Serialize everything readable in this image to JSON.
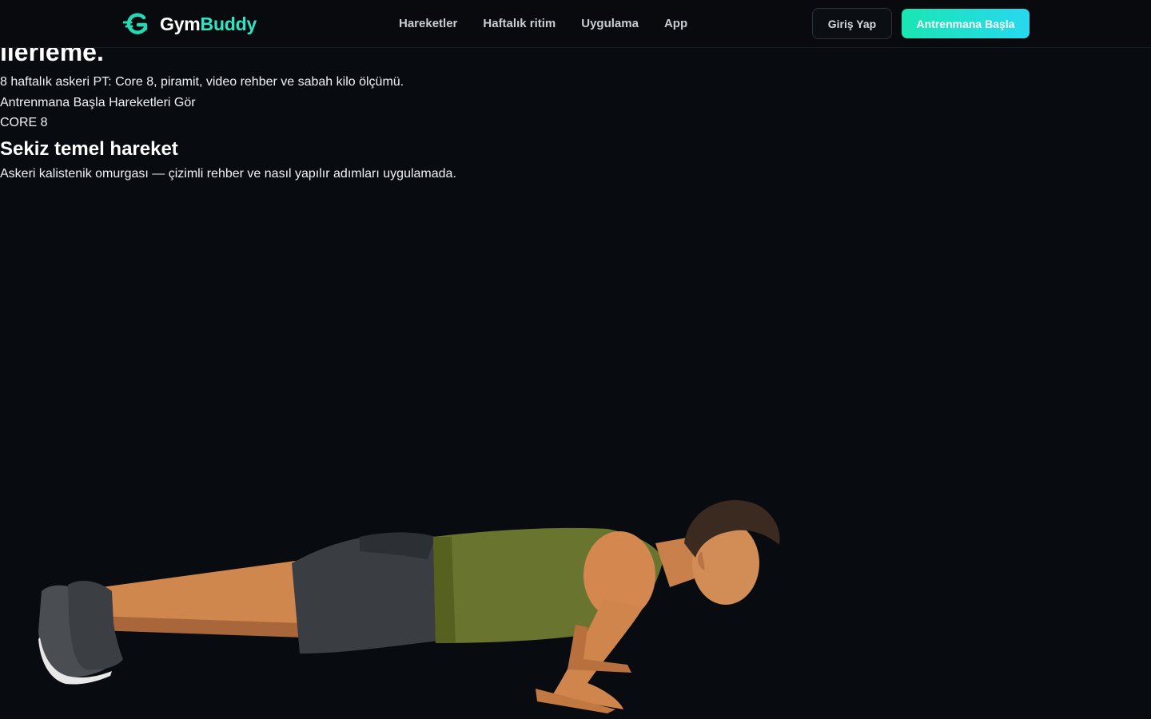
{
  "brand": {
    "name_part1": "Gym",
    "name_part2": "Buddy",
    "accent": "#2ee6c5"
  },
  "nav": {
    "items": [
      {
        "label": "Hareketler"
      },
      {
        "label": "Haftalık ritim"
      },
      {
        "label": "Uygulama"
      },
      {
        "label": "App"
      }
    ]
  },
  "header": {
    "login_label": "Giriş Yap",
    "start_label": "Antrenmana Başla"
  },
  "hero": {
    "heading": "ilerleme.",
    "subtitle": "8 haftalık askeri PT: Core 8, piramit, video rehber ve sabah kilo ölçümü.",
    "cta_primary": "Antrenmana Başla",
    "cta_secondary": "Hareketleri Gör",
    "badge": "CORE 8"
  },
  "section": {
    "title": "Sekiz temel hareket",
    "subtitle": "Askeri kalistenik omurgası — çizimli rehber ve nasıl yapılır adımları uygulamada."
  },
  "illustration": {
    "icon": "pushup-illustration"
  },
  "colors": {
    "background": "#080b0f",
    "button_gradient_start": "#19e6b2",
    "button_gradient_end": "#27d8f0"
  }
}
